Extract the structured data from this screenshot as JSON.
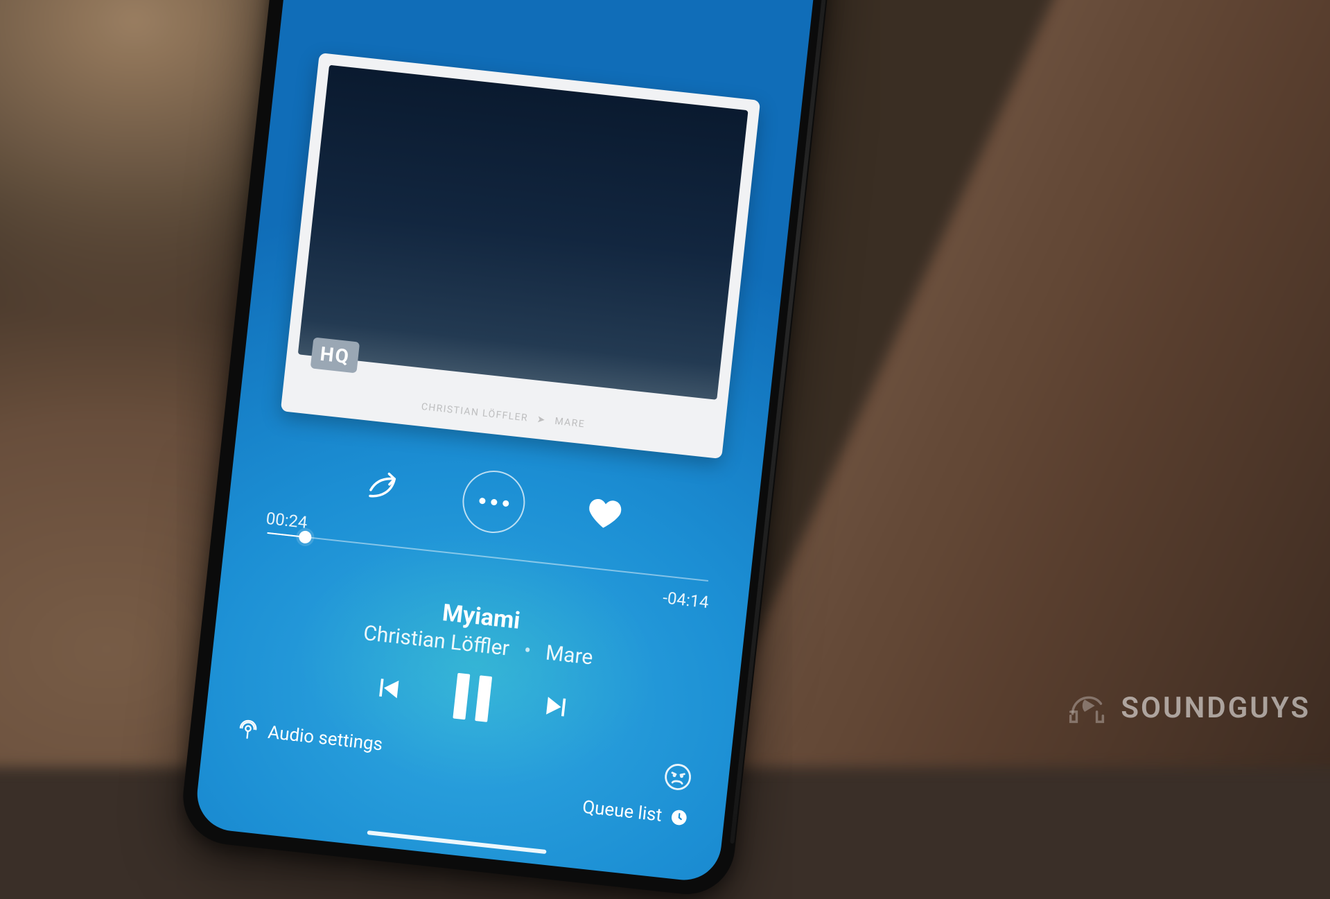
{
  "player": {
    "quality_badge": "HQ",
    "album_art_caption_artist": "CHRISTIAN LÖFFLER",
    "album_art_caption_album": "MARE",
    "elapsed": "00:24",
    "remaining": "-04:14",
    "progress_percent": 8.6,
    "title": "Myiami",
    "artist": "Christian Löffler",
    "album": "Mare",
    "audio_settings_label": "Audio settings",
    "queue_label": "Queue list",
    "icons": {
      "share": "share-icon",
      "more": "more-icon",
      "heart": "heart-icon",
      "prev": "previous-track-icon",
      "pause": "pause-icon",
      "next": "next-track-icon",
      "cast": "cast-icon",
      "angry": "angry-face-icon",
      "clock": "clock-icon"
    }
  },
  "watermark": {
    "text": "SOUNDGUYS"
  },
  "colors": {
    "screen_primary": "#1c8fd4",
    "screen_accent": "#2fa7e0"
  }
}
